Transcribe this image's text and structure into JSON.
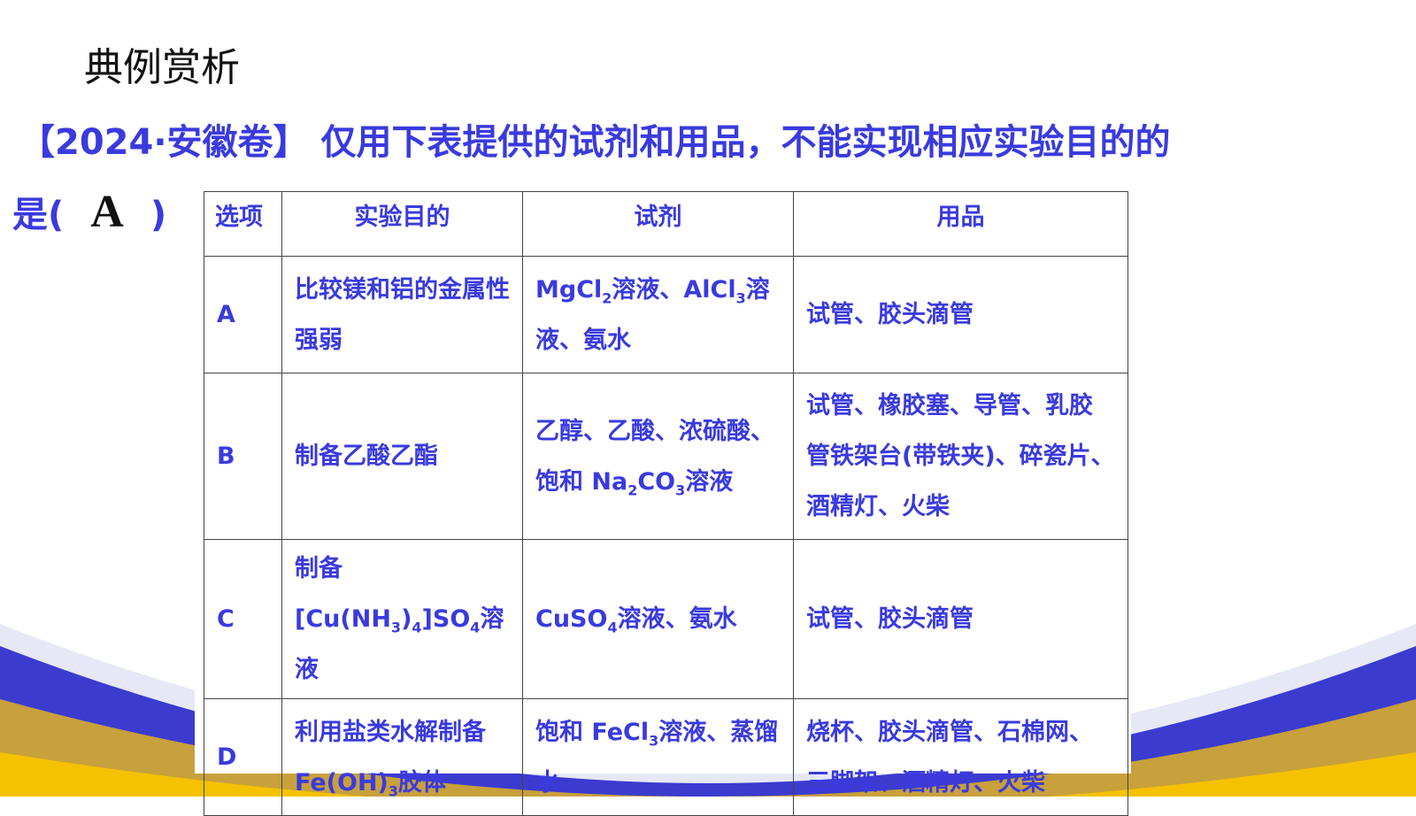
{
  "heading": "典例赏析",
  "question": {
    "source": "【2024·安徽卷】",
    "text": " 仅用下表提供的试剂和用品，不能实现相应实验目的的",
    "prefix": "是(",
    "answer": "A",
    "suffix": ")"
  },
  "table": {
    "headers": [
      "选项",
      "实验目的",
      "试剂",
      "用品"
    ],
    "rows": [
      {
        "option": "A",
        "purpose": "比较镁和铝的金属性强弱",
        "reagents_html": "MgCl<sub>2</sub>溶液、AlCl<sub>3</sub>溶液、氨水",
        "items": "试管、胶头滴管"
      },
      {
        "option": "B",
        "purpose": "制备乙酸乙酯",
        "reagents_html": "乙醇、乙酸、浓硫酸、饱和 Na<sub>2</sub>CO<sub>3</sub>溶液",
        "items": "试管、橡胶塞、导管、乳胶管铁架台(带铁夹)、碎瓷片、酒精灯、火柴"
      },
      {
        "option": "C",
        "purpose_html": "制备[Cu(NH<sub>3</sub>)<sub>4</sub>]SO<sub>4</sub>溶液",
        "reagents_html": "CuSO<sub>4</sub>溶液、氨水",
        "items": "试管、胶头滴管"
      },
      {
        "option": "D",
        "purpose_html": "利用盐类水解制备Fe(OH)<sub>3</sub>胶体",
        "reagents_html": "饱和 FeCl<sub>3</sub>溶液、蒸馏水",
        "items": "烧杯、胶头滴管、石棉网、三脚架、酒精灯、火柴"
      }
    ]
  },
  "colors": {
    "text_blue": "#3a3adf",
    "wave_blue": "#3b3bd0",
    "wave_gold": "#c8a03c",
    "wave_yellow": "#f5c200"
  }
}
